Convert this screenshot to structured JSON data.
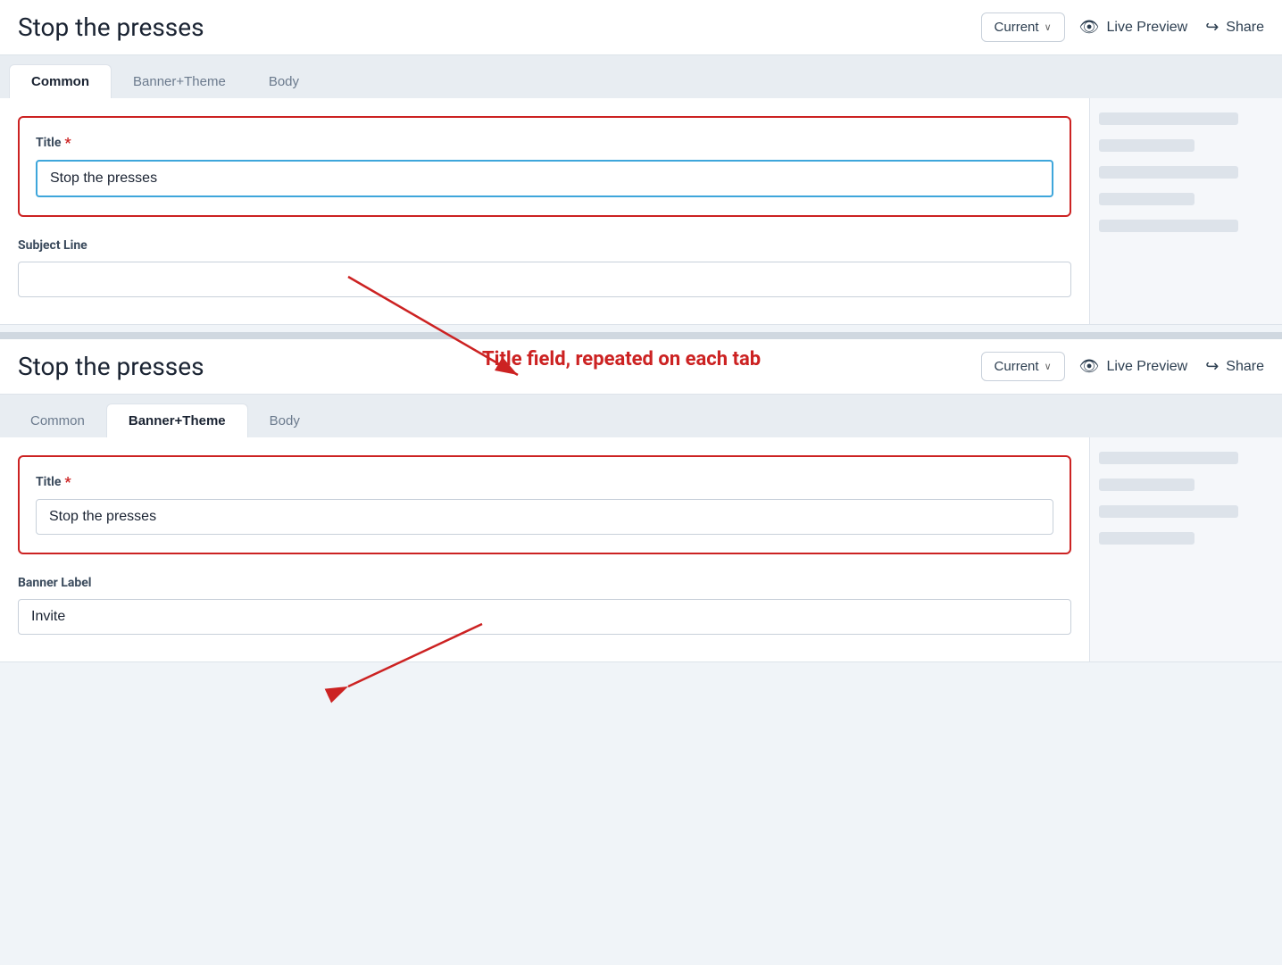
{
  "page": {
    "title": "Stop the presses"
  },
  "top_panel": {
    "title": "Stop the presses",
    "version_label": "Current",
    "live_preview_label": "Live Preview",
    "share_label": "Share",
    "tabs": [
      {
        "id": "common",
        "label": "Common",
        "active": true
      },
      {
        "id": "banner_theme",
        "label": "Banner+Theme",
        "active": false
      },
      {
        "id": "body",
        "label": "Body",
        "active": false
      }
    ],
    "title_field": {
      "label": "Title",
      "required": true,
      "value": "Stop the presses",
      "placeholder": ""
    },
    "subject_field": {
      "label": "Subject Line",
      "value": "",
      "placeholder": ""
    }
  },
  "bottom_panel": {
    "title": "Stop the presses",
    "version_label": "Current",
    "live_preview_label": "Live Preview",
    "share_label": "Share",
    "tabs": [
      {
        "id": "common",
        "label": "Common",
        "active": false
      },
      {
        "id": "banner_theme",
        "label": "Banner+Theme",
        "active": true
      },
      {
        "id": "body",
        "label": "Body",
        "active": false
      }
    ],
    "title_field": {
      "label": "Title",
      "required": true,
      "value": "Stop the presses",
      "placeholder": ""
    },
    "banner_label_field": {
      "label": "Banner Label",
      "value": "Invite",
      "placeholder": ""
    }
  },
  "annotation": {
    "text": "Title field, repeated on each tab"
  },
  "icons": {
    "eye": "👁",
    "share": "↪",
    "chevron": "∨"
  }
}
